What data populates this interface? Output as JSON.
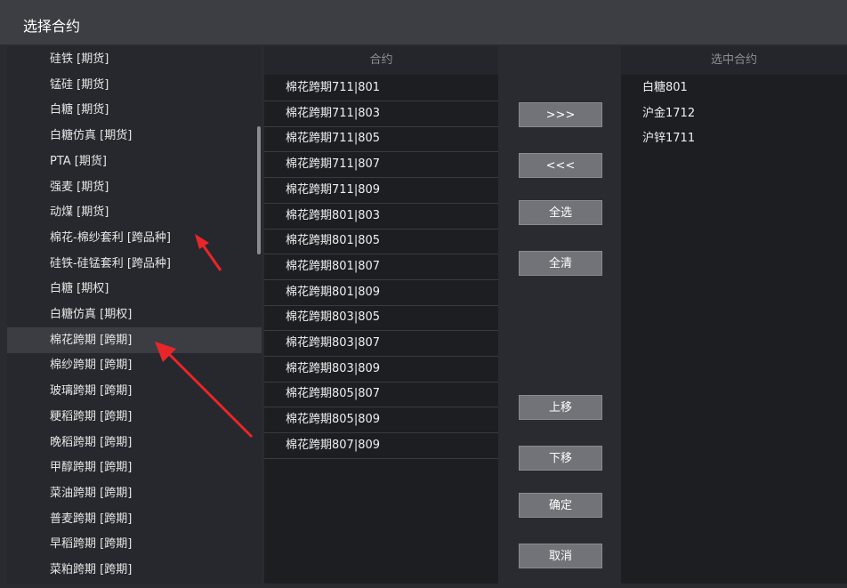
{
  "window": {
    "title": "选择合约"
  },
  "left_list": [
    "硅铁 [期货]",
    "锰硅 [期货]",
    "白糖 [期货]",
    "白糖仿真 [期货]",
    "PTA [期货]",
    "强麦 [期货]",
    "动煤 [期货]",
    "棉花-棉纱套利 [跨品种]",
    "硅铁-硅锰套利 [跨品种]",
    "白糖 [期权]",
    "白糖仿真 [期权]",
    "棉花跨期 [跨期]",
    "棉纱跨期 [跨期]",
    "玻璃跨期 [跨期]",
    "粳稻跨期 [跨期]",
    "晚稻跨期 [跨期]",
    "甲醇跨期 [跨期]",
    "菜油跨期 [跨期]",
    "普麦跨期 [跨期]",
    "早稻跨期 [跨期]",
    "菜粕跨期 [跨期]"
  ],
  "selected_left_index": 11,
  "contracts": {
    "header": "合约",
    "rows": [
      "棉花跨期711|801",
      "棉花跨期711|803",
      "棉花跨期711|805",
      "棉花跨期711|807",
      "棉花跨期711|809",
      "棉花跨期801|803",
      "棉花跨期801|805",
      "棉花跨期801|807",
      "棉花跨期801|809",
      "棉花跨期803|805",
      "棉花跨期803|807",
      "棉花跨期803|809",
      "棉花跨期805|807",
      "棉花跨期805|809",
      "棉花跨期807|809"
    ]
  },
  "buttons": {
    "add": ">>>",
    "remove": "<<<",
    "select_all": "全选",
    "clear_all": "全清",
    "move_up": "上移",
    "move_down": "下移",
    "confirm": "确定",
    "cancel": "取消"
  },
  "selected": {
    "header": "选中合约",
    "rows": [
      "白糖801",
      "沪金1712",
      "沪锌1711"
    ]
  },
  "colors": {
    "annotation_arrow": "#e8262a",
    "background": "#2a2b30",
    "button": "#727379"
  }
}
